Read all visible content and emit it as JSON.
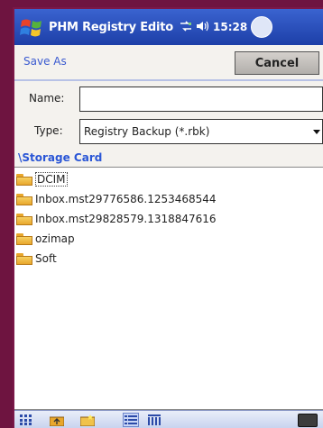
{
  "titlebar": {
    "title": "PHM Registry Edito",
    "clock": "15:28"
  },
  "dialog": {
    "save_as_label": "Save As",
    "cancel_label": "Cancel",
    "name_label": "Name:",
    "name_value": "",
    "type_label": "Type:",
    "type_value": "Registry Backup (*.rbk)",
    "path": "\\Storage Card"
  },
  "files": [
    {
      "name": "DCIM",
      "icon": "folder-icon",
      "selected": true
    },
    {
      "name": "Inbox.mst29776586.1253468544",
      "icon": "folder-icon",
      "selected": false
    },
    {
      "name": "Inbox.mst29828579.1318847616",
      "icon": "folder-icon",
      "selected": false
    },
    {
      "name": "ozimap",
      "icon": "folder-icon",
      "selected": false
    },
    {
      "name": "Soft",
      "icon": "folder-icon",
      "selected": false
    }
  ],
  "colors": {
    "titlebar": "#1d3fa8",
    "accent_text": "#2a56d6",
    "folder": "#e8a72c",
    "frame": "#7a1848"
  }
}
